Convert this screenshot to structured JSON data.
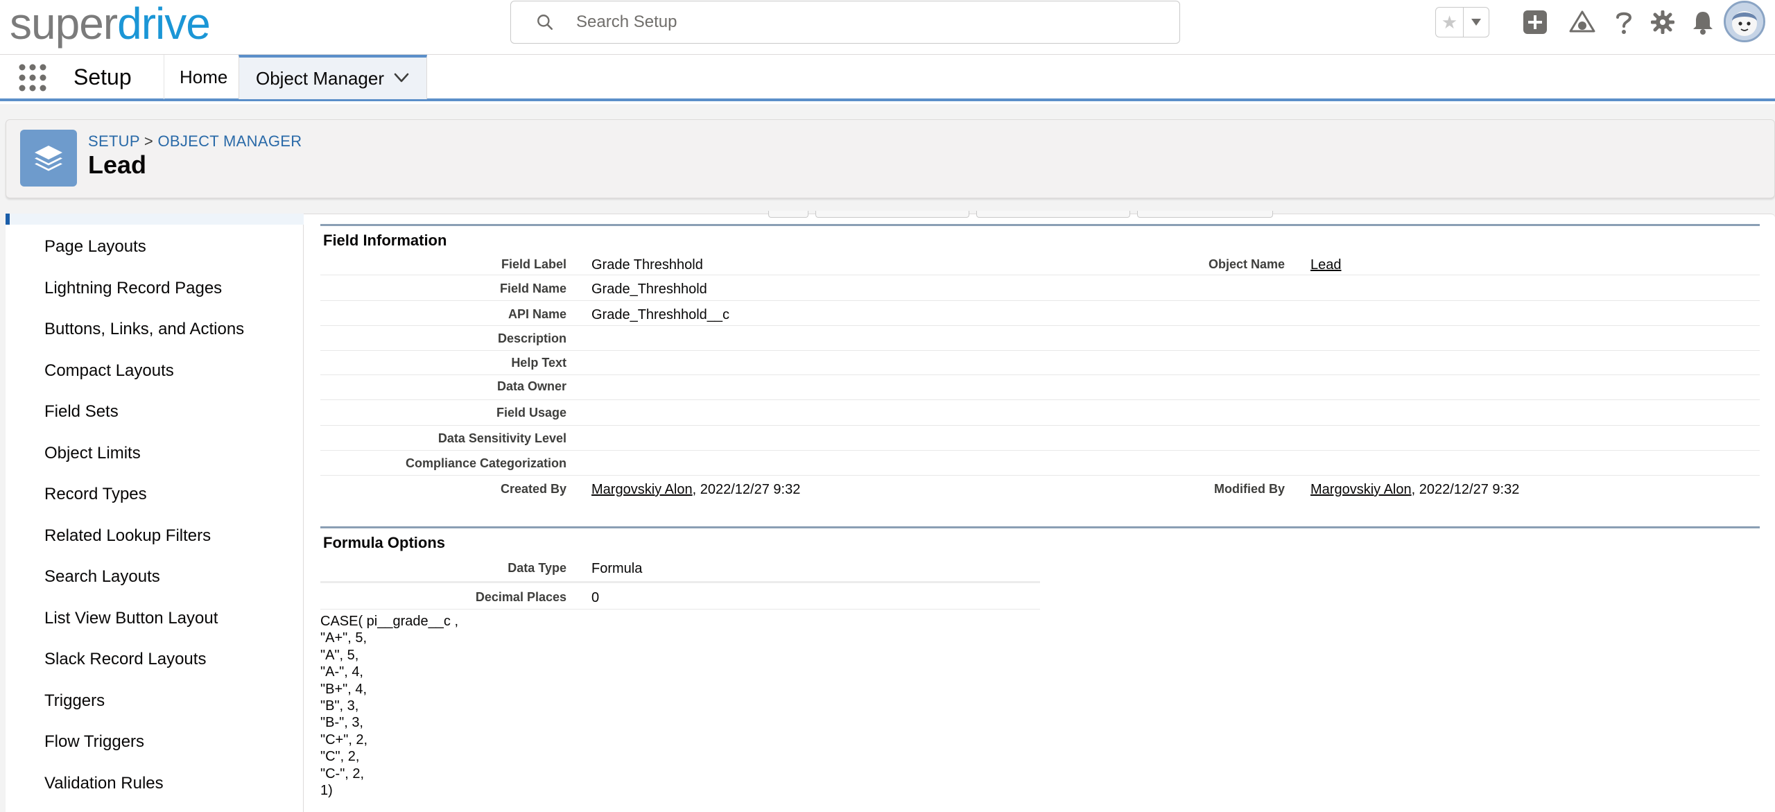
{
  "header": {
    "logo": {
      "part1": "super",
      "part2": "drive"
    },
    "search": {
      "placeholder": "Search Setup"
    },
    "icons": [
      "favorites-star-icon",
      "favorites-menu-icon",
      "add-icon",
      "trailhead-icon",
      "help-icon",
      "settings-gear-icon",
      "notifications-bell-icon",
      "user-avatar"
    ]
  },
  "context_bar": {
    "app_name": "Setup",
    "tabs": [
      {
        "label": "Home"
      },
      {
        "label": "Object Manager"
      }
    ]
  },
  "page_header": {
    "breadcrumb": {
      "setup": "SETUP",
      "separator": ">",
      "object_manager": "OBJECT MANAGER"
    },
    "title": "Lead"
  },
  "sidebar": {
    "items": [
      {
        "label": "Page Layouts"
      },
      {
        "label": "Lightning Record Pages"
      },
      {
        "label": "Buttons, Links, and Actions"
      },
      {
        "label": "Compact Layouts"
      },
      {
        "label": "Field Sets"
      },
      {
        "label": "Object Limits"
      },
      {
        "label": "Record Types"
      },
      {
        "label": "Related Lookup Filters"
      },
      {
        "label": "Search Layouts"
      },
      {
        "label": "List View Button Layout"
      },
      {
        "label": "Slack Record Layouts"
      },
      {
        "label": "Triggers"
      },
      {
        "label": "Flow Triggers"
      },
      {
        "label": "Validation Rules"
      }
    ]
  },
  "field_information": {
    "title": "Field Information",
    "field_label": {
      "label": "Field Label",
      "value": "Grade Threshhold"
    },
    "object_name": {
      "label": "Object Name",
      "value": "Lead"
    },
    "field_name": {
      "label": "Field Name",
      "value": "Grade_Threshhold"
    },
    "api_name": {
      "label": "API Name",
      "value": "Grade_Threshhold__c"
    },
    "description": {
      "label": "Description",
      "value": ""
    },
    "help_text": {
      "label": "Help Text",
      "value": ""
    },
    "data_owner": {
      "label": "Data Owner",
      "value": ""
    },
    "field_usage": {
      "label": "Field Usage",
      "value": ""
    },
    "data_sensitivity": {
      "label": "Data Sensitivity Level",
      "value": ""
    },
    "compliance": {
      "label": "Compliance Categorization",
      "value": ""
    },
    "created_by": {
      "label": "Created By",
      "user": "Margovskiy Alon",
      "date": ", 2022/12/27 9:32"
    },
    "modified_by": {
      "label": "Modified By",
      "user": "Margovskiy Alon",
      "date": ", 2022/12/27 9:32"
    }
  },
  "formula_options": {
    "title": "Formula Options",
    "data_type": {
      "label": "Data Type",
      "value": "Formula"
    },
    "decimal_places": {
      "label": "Decimal Places",
      "value": "0"
    },
    "formula": "CASE( pi__grade__c ,\n\"A+\", 5,\n\"A\", 5,\n\"A-\", 4,\n\"B+\", 4,\n\"B\", 3,\n\"B-\", 3,\n\"C+\", 2,\n\"C\", 2,\n\"C-\", 2,\n1)"
  },
  "colors": {
    "brand_blue": "#1b96d6",
    "accent_blue": "#5b8fc9",
    "link_blue": "#2a6aa8"
  }
}
